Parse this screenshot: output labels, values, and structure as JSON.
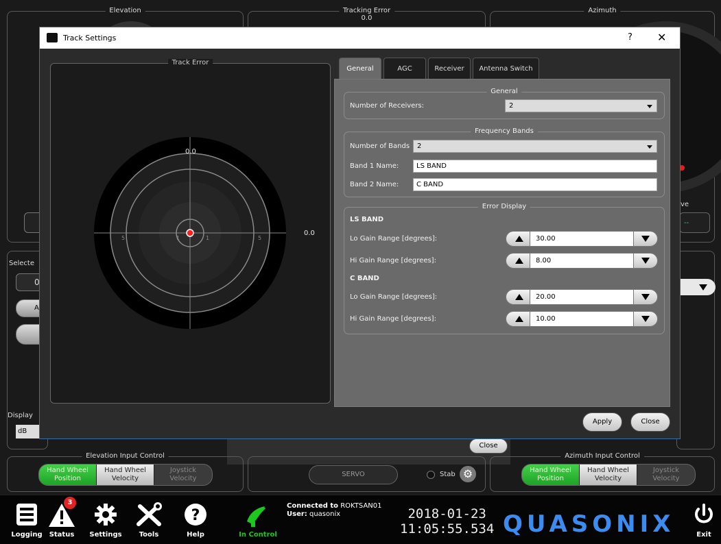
{
  "background": {
    "elevation_title": "Elevation",
    "tracking_error_title": "Tracking Error",
    "tracking_error_value": "0.0",
    "azimuth_title": "Azimuth",
    "left_selected_label": "Selecte",
    "left_selected_value": "0",
    "left_button_label": "A",
    "display_label": "Display",
    "display_value": "dB",
    "right_partial_label": "ve",
    "right_partial_value": "--",
    "behind_close_label": "Close",
    "servo_label": "SERVO",
    "stab_label": "Stab",
    "elevation_input_title": "Elevation Input Control",
    "azimuth_input_title": "Azimuth Input Control",
    "elevation_input_buttons": [
      {
        "line1": "Hand Wheel",
        "line2": "Position"
      },
      {
        "line1": "Hand Wheel",
        "line2": "Velocity"
      },
      {
        "line1": "Joystick",
        "line2": "Velocity"
      }
    ],
    "azimuth_input_buttons": [
      {
        "line1": "Hand Wheel",
        "line2": "Position"
      },
      {
        "line1": "Hand Wheel",
        "line2": "Velocity"
      },
      {
        "line1": "Joystick",
        "line2": "Velocity"
      }
    ]
  },
  "dialog": {
    "title": "Track Settings",
    "help_label": "?",
    "close_glyph": "✕",
    "track_error": {
      "title": "Track Error",
      "top_value": "0.0",
      "right_value": "0.0",
      "axis_labels": [
        "5",
        "1",
        "1",
        "5"
      ]
    },
    "tabs": [
      "General",
      "AGC",
      "Receiver",
      "Antenna Switch"
    ],
    "active_tab": "General",
    "general_group": {
      "title": "General",
      "receivers_label": "Number of Receivers:",
      "receivers_value": "2"
    },
    "bands_group": {
      "title": "Frequency Bands",
      "bands_label": "Number of Bands",
      "bands_value": "2",
      "band1_label": "Band 1 Name:",
      "band1_value": "LS BAND",
      "band2_label": "Band 2 Name:",
      "band2_value": "C BAND"
    },
    "error_group": {
      "title": "Error Display",
      "ls_header": "LS BAND",
      "ls_lo_label": "Lo Gain Range [degrees]:",
      "ls_lo_value": "30.00",
      "ls_hi_label": "Hi Gain Range [degrees]:",
      "ls_hi_value": "8.00",
      "c_header": "C BAND",
      "c_lo_label": "Lo Gain Range [degrees]:",
      "c_lo_value": "20.00",
      "c_hi_label": "Hi Gain Range [degrees]:",
      "c_hi_value": "10.00"
    },
    "apply_label": "Apply",
    "close_label": "Close"
  },
  "toolbar": {
    "items": [
      {
        "label": "Logging",
        "icon": "logging-icon"
      },
      {
        "label": "Status",
        "icon": "warning-icon",
        "badge": "3"
      },
      {
        "label": "Settings",
        "icon": "gear-icon"
      },
      {
        "label": "Tools",
        "icon": "tools-icon"
      },
      {
        "label": "Help",
        "icon": "help-icon"
      },
      {
        "label": "In Control",
        "icon": "antenna-icon"
      },
      {
        "label": "Exit",
        "icon": "power-icon"
      }
    ],
    "connected_prefix": "Connected to",
    "connected_host": "ROKTSAN01",
    "user_prefix": "User:",
    "user_name": "quasonix",
    "date": "2018-01-23",
    "time": "11:05:55.534",
    "brand": "QUASONIX",
    "colors": {
      "brand": "#3b8bf0",
      "in_control": "#1ec71e",
      "badge": "#e12323",
      "active_green": "#2fbb33"
    }
  }
}
